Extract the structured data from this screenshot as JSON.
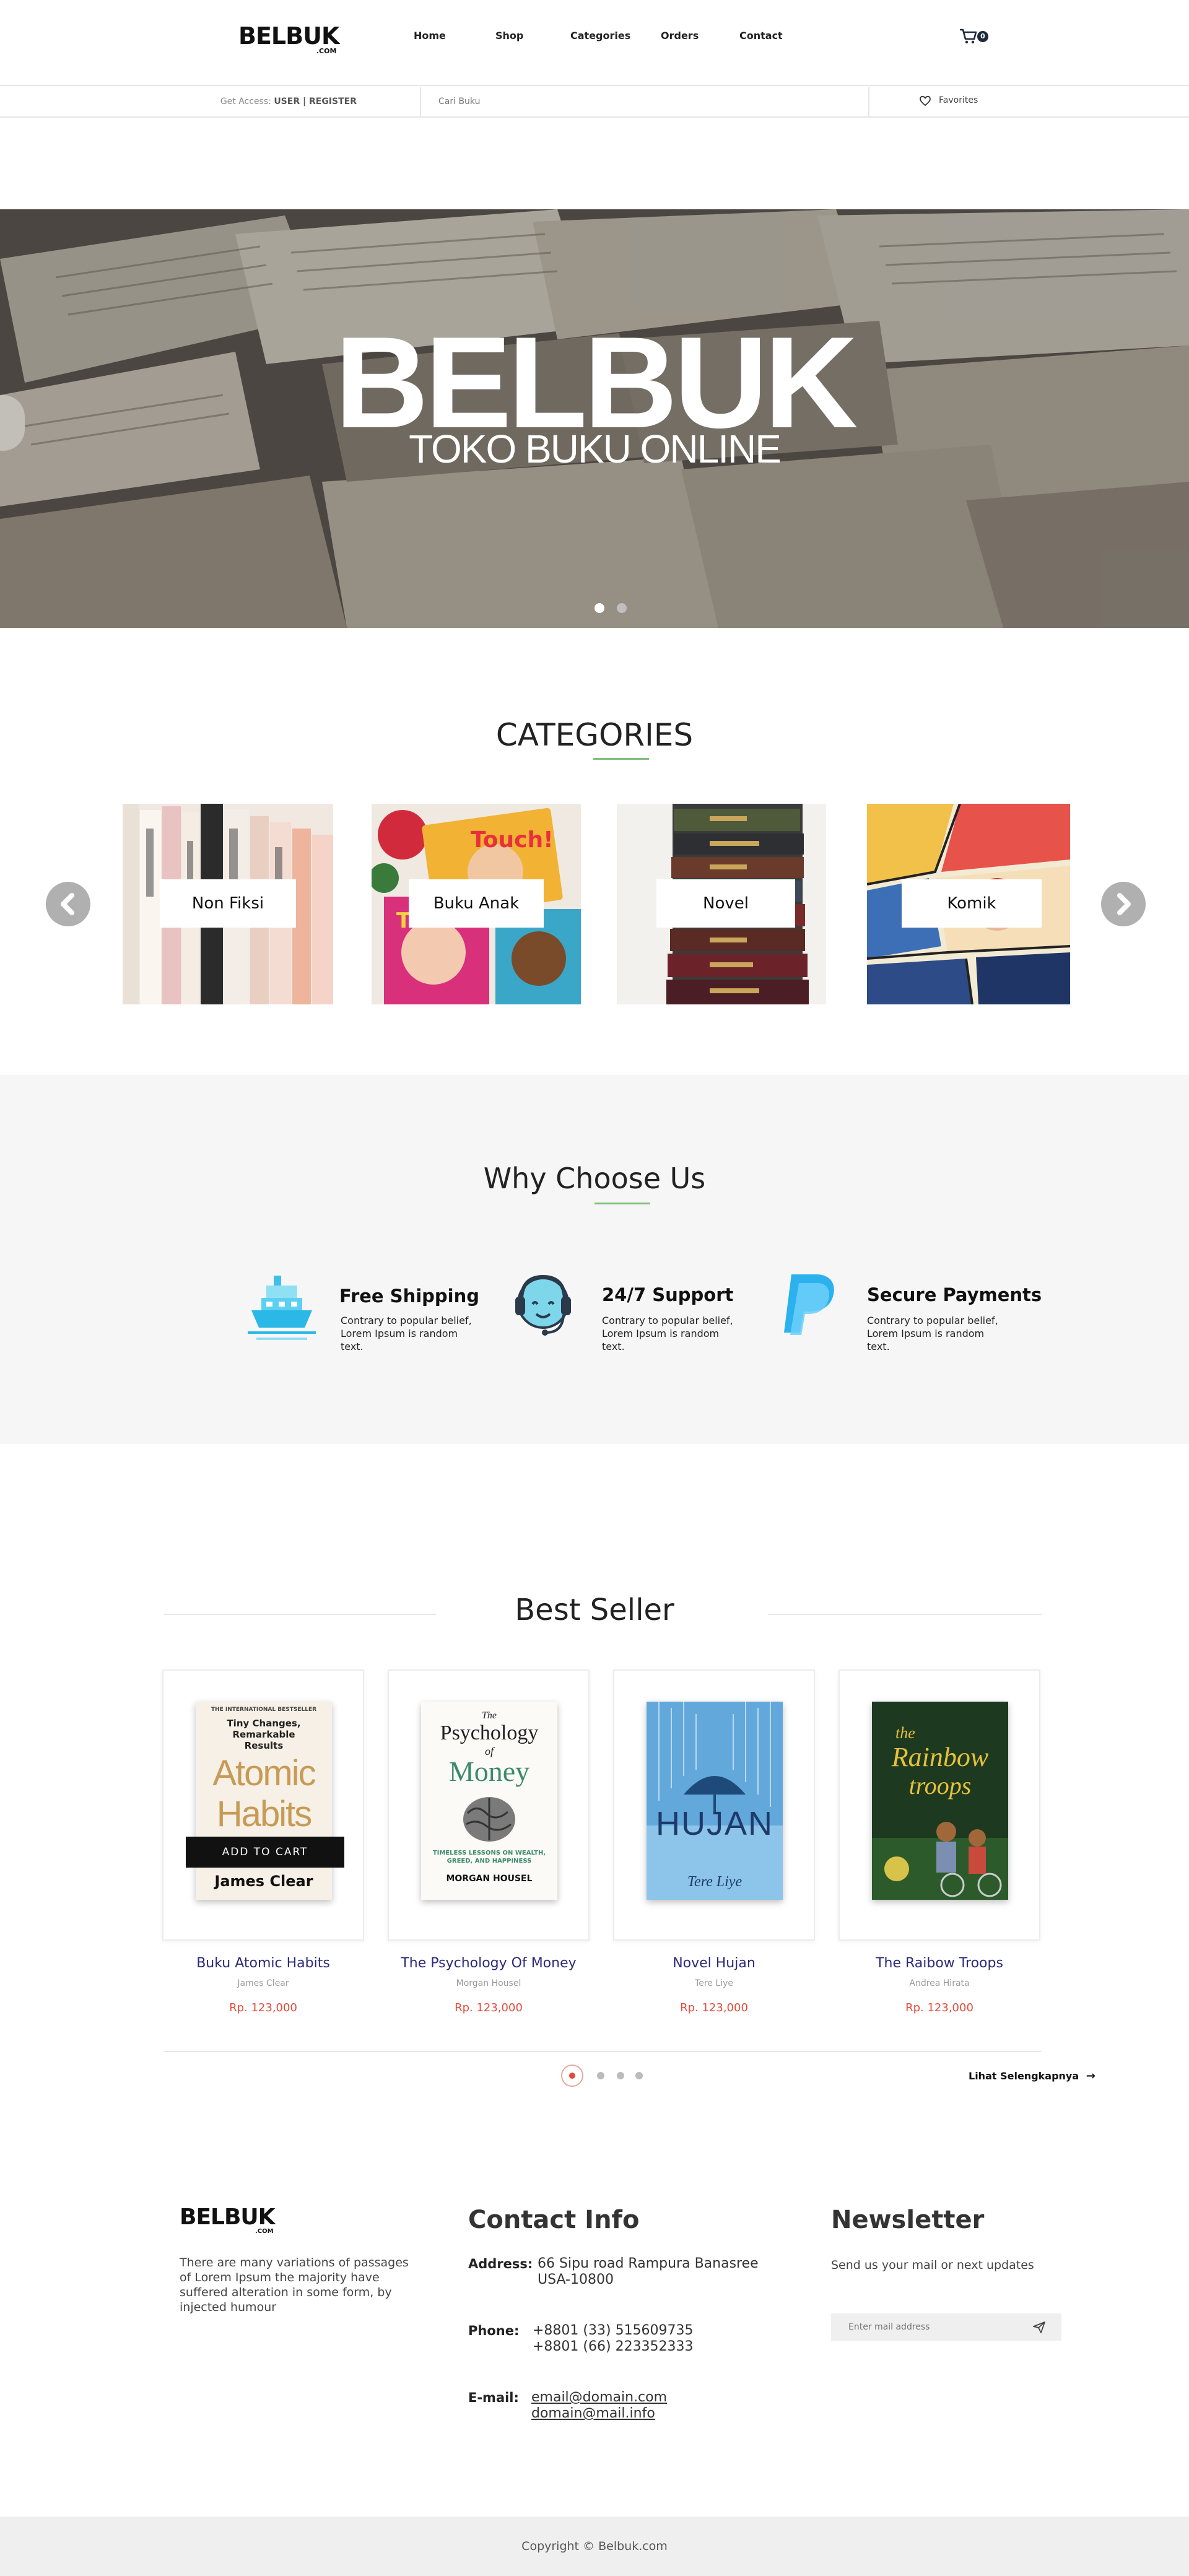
{
  "header": {
    "logo": "BELBUK",
    "logo_sub": ".COM",
    "nav": [
      {
        "label": "Home"
      },
      {
        "label": "Shop"
      },
      {
        "label": "Categories"
      },
      {
        "label": "Orders"
      },
      {
        "label": "Contact"
      }
    ],
    "cart_count": "0"
  },
  "subbar": {
    "access_prefix": "Get Access:",
    "access_links": "USER | REGISTER",
    "search_placeholder": "Cari Buku",
    "favorites_label": "Favorites"
  },
  "hero": {
    "title": "BELBUK",
    "subtitle": "TOKO BUKU ONLINE",
    "slides": 2,
    "active_slide": 0
  },
  "categories": {
    "title": "CATEGORIES",
    "items": [
      {
        "label": "Non Fiksi"
      },
      {
        "label": "Buku Anak"
      },
      {
        "label": "Novel"
      },
      {
        "label": "Komik"
      }
    ]
  },
  "why": {
    "title": "Why Choose Us",
    "features": [
      {
        "title": "Free Shipping",
        "desc": "Contrary to popular belief, Lorem Ipsum is random text.",
        "icon": "ship-icon"
      },
      {
        "title": "24/7 Support",
        "desc": "Contrary to popular belief, Lorem Ipsum is random text.",
        "icon": "headset-icon"
      },
      {
        "title": "Secure Payments",
        "desc": "Contrary to popular belief, Lorem Ipsum is random text.",
        "icon": "paypal-icon"
      }
    ]
  },
  "bestseller": {
    "title": "Best Seller",
    "add_to_cart": "ADD TO CART",
    "more_link": "Lihat Selengkapnya",
    "books": [
      {
        "title": "Buku Atomic Habits",
        "author": "James Clear",
        "price": "Rp. 123,000",
        "cover": {
          "top": "THE INTERNATIONAL BESTSELLER",
          "tag": "Tiny Changes, Remarkable Results",
          "name1": "Atomic",
          "name2": "Habits",
          "author": "James Clear"
        }
      },
      {
        "title": "The Psychology Of Money",
        "author": "Morgan Housel",
        "price": "Rp. 123,000",
        "cover": {
          "top": "The",
          "name1": "Psychology",
          "name2": "of",
          "name3": "Money",
          "tag": "TIMELESS LESSONS ON WEALTH, GREED, AND HAPPINESS",
          "author": "MORGAN HOUSEL"
        }
      },
      {
        "title": "Novel Hujan",
        "author": "Tere Liye",
        "price": "Rp. 123,000",
        "cover": {
          "name1": "HUJAN",
          "author": "Tere Liye"
        }
      },
      {
        "title": "The Raibow Troops",
        "author": "Andrea Hirata",
        "price": "Rp. 123,000",
        "cover": {
          "name1": "the",
          "name2": "Rainbow",
          "name3": "troops"
        }
      }
    ],
    "pages": 4,
    "active_page": 0
  },
  "footer": {
    "logo": "BELBUK",
    "logo_sub": ".COM",
    "about": "There are many variations of passages of Lorem Ipsum the majority have suffered alteration in some form, by injected humour",
    "contact_title": "Contact Info",
    "address_label": "Address:",
    "address_lines": [
      "66 Sipu road Rampura Banasree",
      "USA-10800"
    ],
    "phone_label": "Phone:",
    "phone_lines": [
      "+8801 (33) 515609735",
      "+8801 (66) 223352333"
    ],
    "email_label": "E-mail:",
    "email_lines": [
      "email@domain.com",
      "domain@mail.info"
    ],
    "newsletter_title": "Newsletter",
    "newsletter_text": "Send us your mail or next updates",
    "newsletter_placeholder": "Enter mail address",
    "copyright": "Copyright © Belbuk.com"
  },
  "colors": {
    "accent_green": "#7ec07a",
    "price_red": "#e24a3b",
    "title_navy": "#2b2a7a"
  }
}
